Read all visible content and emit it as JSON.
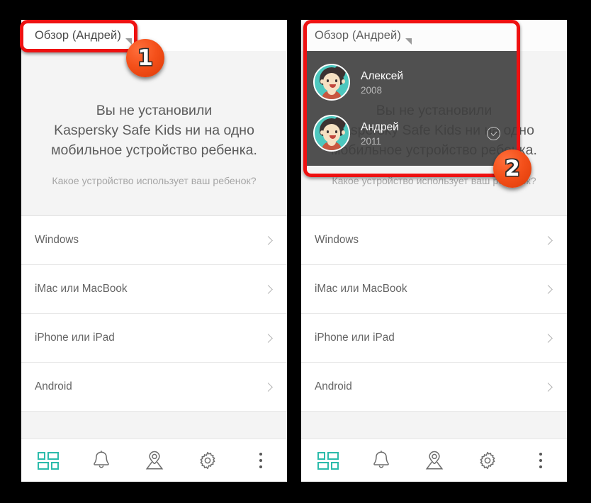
{
  "annotations": {
    "badges": [
      {
        "id": "1",
        "label": "1"
      },
      {
        "id": "2",
        "label": "2"
      }
    ]
  },
  "left_panel": {
    "header": {
      "title": "Обзор (Андрей)",
      "caret_icon": "triangle-down-icon"
    },
    "hero": {
      "title_line1": "Вы не установили",
      "title_line2": "Kaspersky Safe Kids ни на одно",
      "title_line3": "мобильное устройство ребенка.",
      "subtitle": "Какое устройство использует ваш ребенок?"
    },
    "devices": [
      {
        "label": "Windows",
        "chevron": "chevron-right-icon"
      },
      {
        "label": "iMac или MacBook",
        "chevron": "chevron-right-icon"
      },
      {
        "label": "iPhone или iPad",
        "chevron": "chevron-right-icon"
      },
      {
        "label": "Android",
        "chevron": "chevron-right-icon"
      }
    ],
    "bottom_nav": [
      {
        "icon": "dashboard-icon",
        "active": true
      },
      {
        "icon": "bell-icon",
        "active": false
      },
      {
        "icon": "location-pin-icon",
        "active": false
      },
      {
        "icon": "gear-icon",
        "active": false
      },
      {
        "icon": "overflow-menu-icon",
        "active": false
      }
    ]
  },
  "right_panel": {
    "header": {
      "title": "Обзор (Андрей)",
      "caret_icon": "triangle-down-icon"
    },
    "dropdown": {
      "items": [
        {
          "name": "Алексей",
          "year": "2008",
          "selected": false
        },
        {
          "name": "Андрей",
          "year": "2011",
          "selected": true,
          "check_icon": "check-circle-icon"
        }
      ]
    },
    "hero": {
      "title_line1": "Вы не установили",
      "title_line2": "Kaspersky Safe Kids ни на одно",
      "title_line3": "мобильное устройство ребенка.",
      "subtitle": "Какое устройство использует ваш ребенок?"
    },
    "devices": [
      {
        "label": "Windows",
        "chevron": "chevron-right-icon"
      },
      {
        "label": "iMac или MacBook",
        "chevron": "chevron-right-icon"
      },
      {
        "label": "iPhone или iPad",
        "chevron": "chevron-right-icon"
      },
      {
        "label": "Android",
        "chevron": "chevron-right-icon"
      }
    ],
    "bottom_nav": [
      {
        "icon": "dashboard-icon",
        "active": true
      },
      {
        "icon": "bell-icon",
        "active": false
      },
      {
        "icon": "location-pin-icon",
        "active": false
      },
      {
        "icon": "gear-icon",
        "active": false
      },
      {
        "icon": "overflow-menu-icon",
        "active": false
      }
    ]
  },
  "colors": {
    "accent_teal": "#2bbbab",
    "avatar_teal": "#4dc7be",
    "annotation_red": "#ee1111",
    "badge_orange": "#f4501a"
  }
}
